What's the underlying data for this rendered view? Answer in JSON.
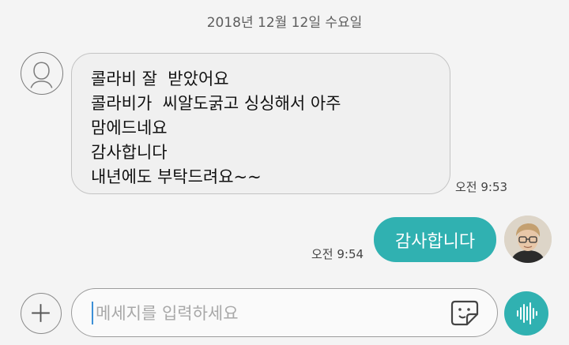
{
  "chat": {
    "date": "2018년 12월 12일 수요일",
    "incoming": {
      "lines": [
        "콜라비 잘  받았어요",
        "콜라비가  씨알도굵고 싱싱해서 아주",
        "맘에드네요",
        "감사합니다",
        "내년에도 부탁드려요~~"
      ],
      "time": "오전 9:53",
      "avatar_icon": "person-outline-icon"
    },
    "outgoing": {
      "text": "감사합니다",
      "time": "오전 9:54",
      "avatar_icon": "profile-photo"
    }
  },
  "composer": {
    "placeholder": "메세지를 입력하세요",
    "value": "",
    "attach_icon": "plus-icon",
    "sticker_icon": "sticker-icon",
    "voice_icon": "voice-wave-icon"
  },
  "colors": {
    "accent": "#30b1b1",
    "background": "#f4f4f4",
    "bubble_in": "#f0f0f0"
  }
}
